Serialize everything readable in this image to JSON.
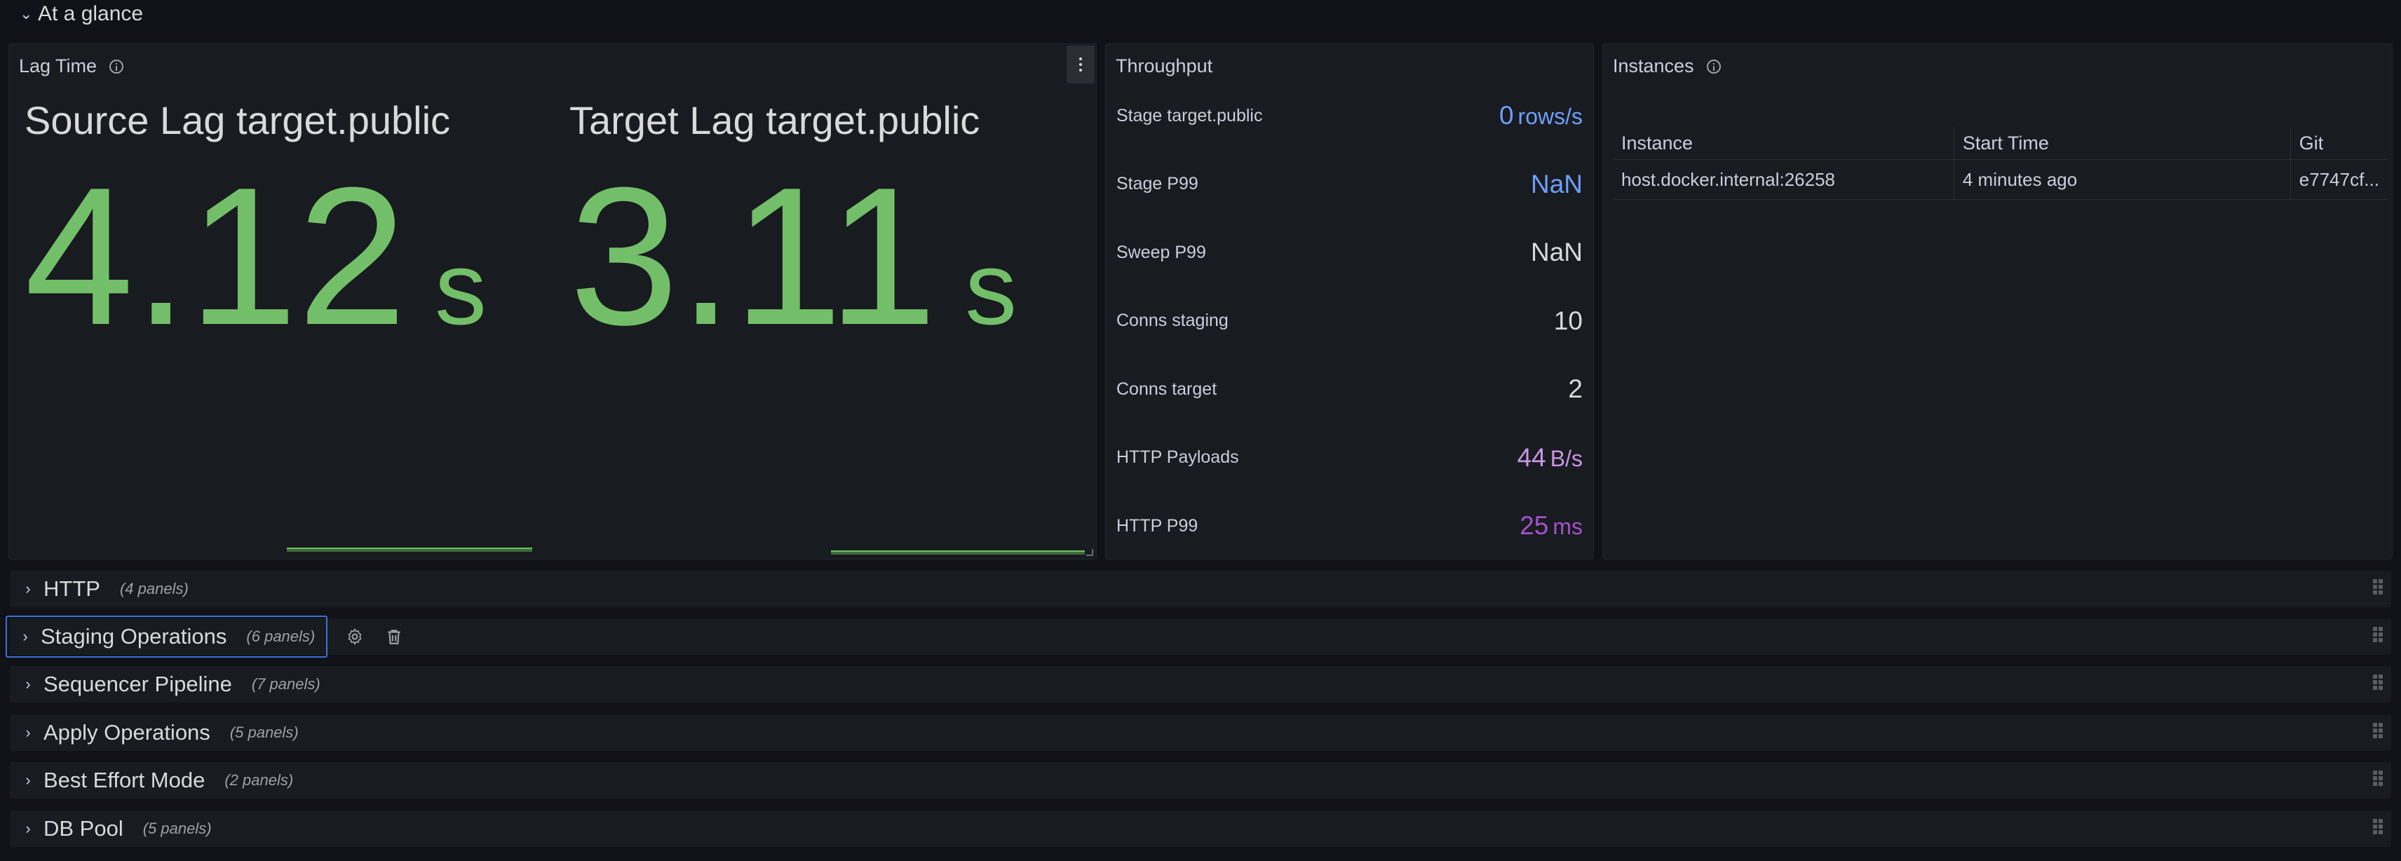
{
  "top_row": {
    "title": "At a glance"
  },
  "lag_panel": {
    "title": "Lag Time",
    "source": {
      "label": "Source Lag target.public",
      "value": "4.12",
      "unit": "s"
    },
    "target": {
      "label": "Target Lag target.public",
      "value": "3.11",
      "unit": "s"
    }
  },
  "throughput": {
    "title": "Throughput",
    "rows": [
      {
        "label": "Stage target.public",
        "value": "0",
        "unit": "rows/s",
        "color": "#6e9fff"
      },
      {
        "label": "Stage P99",
        "value": "NaN",
        "unit": "",
        "color": "#6e9fff"
      },
      {
        "label": "Sweep P99",
        "value": "NaN",
        "unit": "",
        "color": "#d8d9da"
      },
      {
        "label": "Conns staging",
        "value": "10",
        "unit": "",
        "color": "#d8d9da"
      },
      {
        "label": "Conns target",
        "value": "2",
        "unit": "",
        "color": "#d8d9da"
      },
      {
        "label": "HTTP Payloads",
        "value": "44",
        "unit": "B/s",
        "color": "#ca95e5"
      },
      {
        "label": "HTTP P99",
        "value": "25",
        "unit": "ms",
        "color": "#a352cc"
      }
    ]
  },
  "instances": {
    "title": "Instances",
    "columns": [
      "Instance",
      "Start Time",
      "Git"
    ],
    "rows": [
      [
        "host.docker.internal:26258",
        "4 minutes ago",
        "e7747cf..."
      ]
    ]
  },
  "rows": [
    {
      "title": "HTTP",
      "count": "(4 panels)"
    },
    {
      "title": "Staging Operations",
      "count": "(6 panels)"
    },
    {
      "title": "Sequencer Pipeline",
      "count": "(7 panels)"
    },
    {
      "title": "Apply Operations",
      "count": "(5 panels)"
    },
    {
      "title": "Best Effort Mode",
      "count": "(2 panels)"
    },
    {
      "title": "DB Pool",
      "count": "(5 panels)"
    }
  ],
  "colors": {
    "stat_green": "#73bf69",
    "selected_border": "#3d71d9"
  }
}
